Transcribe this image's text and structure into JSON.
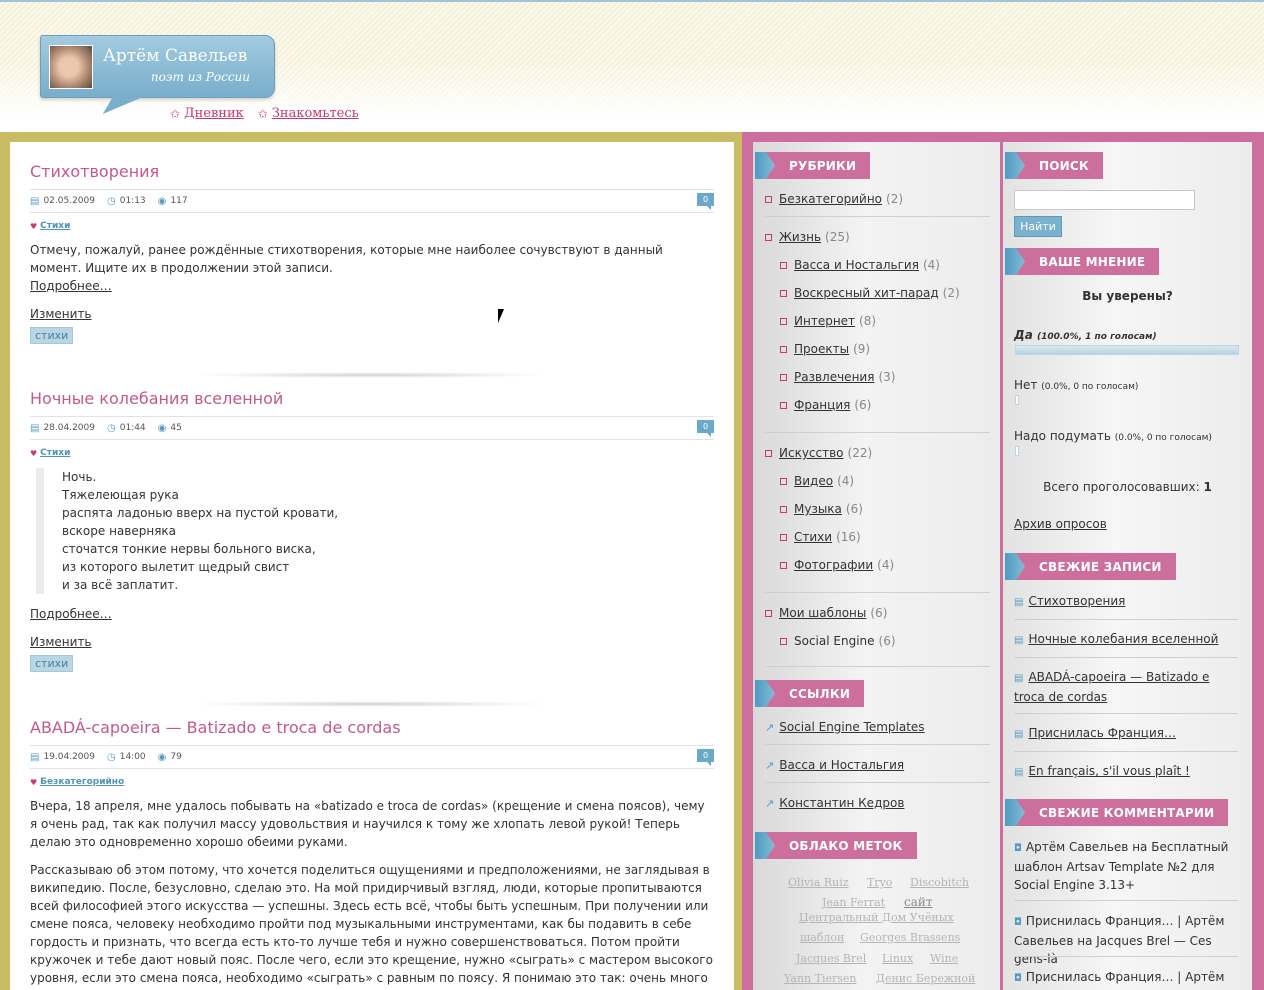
{
  "header": {
    "site_title": "Артём Савельев",
    "tagline": "поэт из России",
    "nav": [
      "Дневник",
      "Знакомьтесь"
    ]
  },
  "posts": [
    {
      "title": "Стихотворения",
      "date": "02.05.2009",
      "time": "01:13",
      "views": "117",
      "comments": "0",
      "category": "Стихи",
      "text": "Отмечу, пожалуй, ранее рождённые стихотворения, которые мне наиболее сочувствуют в данный момент. Ищите их в продолжении этой записи.",
      "more": "Подробнее…",
      "edit": "Изменить",
      "tag": "стихи"
    },
    {
      "title": "Ночные колебания вселенной",
      "date": "28.04.2009",
      "time": "01:44",
      "views": "45",
      "comments": "0",
      "category": "Стихи",
      "quote_lines": [
        "Ночь.",
        "Тяжелеющая рука",
        "распята ладонью вверх на пустой кровати,",
        "вскоре наверняка",
        "сточатся тонкие нервы больного виска,",
        "из которого вылетит щедрый свист",
        "и за всё заплатит."
      ],
      "more": "Подробнее…",
      "edit": "Изменить",
      "tag": "стихи"
    },
    {
      "title": "ABADÁ-capoeira — Batizado e troca de cordas",
      "date": "19.04.2009",
      "time": "14:00",
      "views": "79",
      "comments": "0",
      "category": "Безкатегорийно",
      "para1": "Вчера, 18 апреля, мне удалось побывать на «batizado e troca de cordas» (крещение и смена поясов), чему я очень рад, так как получил массу удовольствия и научился к тому же хлопать левой рукой! Теперь делаю это одновременно хорошо обеими руками.",
      "para2": "Рассказываю об этом потому, что хочется поделиться ощущениями и предположениями, не заглядывая в википедию. После, безусловно, сделаю это. На мой придирчивый взгляд, люди, которые пропитываются всей философией этого искусства — успешны. Здесь есть всё, чтобы быть успешным. При получении или смене пояса, человеку необходимо пройти под музыкальными инструментами, как бы подавить в себе гордость и признать, что всегда есть кто-то лучше тебя и нужно совершенствоваться. Потом пройти кружочек и тебе дают новый пояс. После чего, если это крещение, нужно «сыграть» с мастером высокого уровня, если это смена пояса, необходимо «сыграть» с равным по поясу. Я понимаю это так: очень много и упорно занимаясь любимым делом, в обозначенное"
    }
  ],
  "sidebar": {
    "rubrics_title": "РУБРИКИ",
    "categories": [
      {
        "label": "Безкатегорийно",
        "count": "(2)"
      },
      {
        "label": "Жизнь",
        "count": "(25)"
      },
      {
        "label": "Васса и Ностальгия",
        "count": "(4)"
      },
      {
        "label": "Воскресный хит-парад",
        "count": "(2)"
      },
      {
        "label": "Интернет",
        "count": "(8)"
      },
      {
        "label": "Проекты",
        "count": "(9)"
      },
      {
        "label": "Развлечения",
        "count": "(3)"
      },
      {
        "label": "Франция",
        "count": "(6)"
      },
      {
        "label": "Искусство",
        "count": "(22)"
      },
      {
        "label": "Видео",
        "count": "(4)"
      },
      {
        "label": "Музыка",
        "count": "(6)"
      },
      {
        "label": "Стихи",
        "count": "(16)"
      },
      {
        "label": "Фотографии",
        "count": "(4)"
      },
      {
        "label": "Мои шаблоны",
        "count": "(6)"
      },
      {
        "label": "Social Engine",
        "count": "(6)"
      }
    ],
    "links_title": "ССЫЛКИ",
    "links": [
      "Social Engine Templates",
      "Васса и Ностальгия",
      "Константин Кедров"
    ],
    "tags_title": "ОБЛАКО МЕТОК",
    "tags": [
      "Olivia Ruiz",
      "Tryo",
      "Discobitch",
      "Jean Ferrat",
      "сайт",
      "Центральный Дом Учёных",
      "шаблон",
      "Georges Brassens",
      "Jacques Brel",
      "Linux",
      "Wine",
      "Yann Tiersen",
      "Денис Бережной"
    ],
    "search_title": "ПОИСК",
    "search_button": "Найти",
    "search_value": "",
    "poll_title": "ВАШЕ МНЕНИЕ",
    "poll_question": "Вы уверены?",
    "poll_answers": [
      {
        "label": "Да",
        "detail": "(100.0%, 1 по голосам)",
        "share": 1.0
      },
      {
        "label": "Нет",
        "detail": "(0.0%, 0 по голосам)",
        "share": 0.0
      },
      {
        "label": "Надо подумать",
        "detail": "(0.0%, 0 по голосам)",
        "share": 0.0
      }
    ],
    "poll_total_label": "Всего проголосовавших:",
    "poll_total_value": "1",
    "poll_archive": "Архив опросов",
    "recent_title": "СВЕЖИЕ ЗАПИСИ",
    "recent": [
      "Стихотворения",
      "Ночные колебания вселенной",
      "ABADÁ-capoeira — Batizado e troca de cordas",
      "Приснилась Франция…",
      "En français, s'il vous plaît !"
    ],
    "comments_title": "СВЕЖИЕ КОММЕНТАРИИ",
    "comments": [
      {
        "author": "Артём Савельев",
        "on": "на",
        "post": "Бесплатный шаблон Artsav Template №2 для Social Engine 3.13+"
      },
      {
        "author": "Приснилась Франция… | Артём Савельев",
        "on": "на",
        "post": "Jacques Brel — Ces gens-là"
      },
      {
        "author": "Приснилась Франция… | Артём",
        "on": "",
        "post": ""
      }
    ]
  }
}
